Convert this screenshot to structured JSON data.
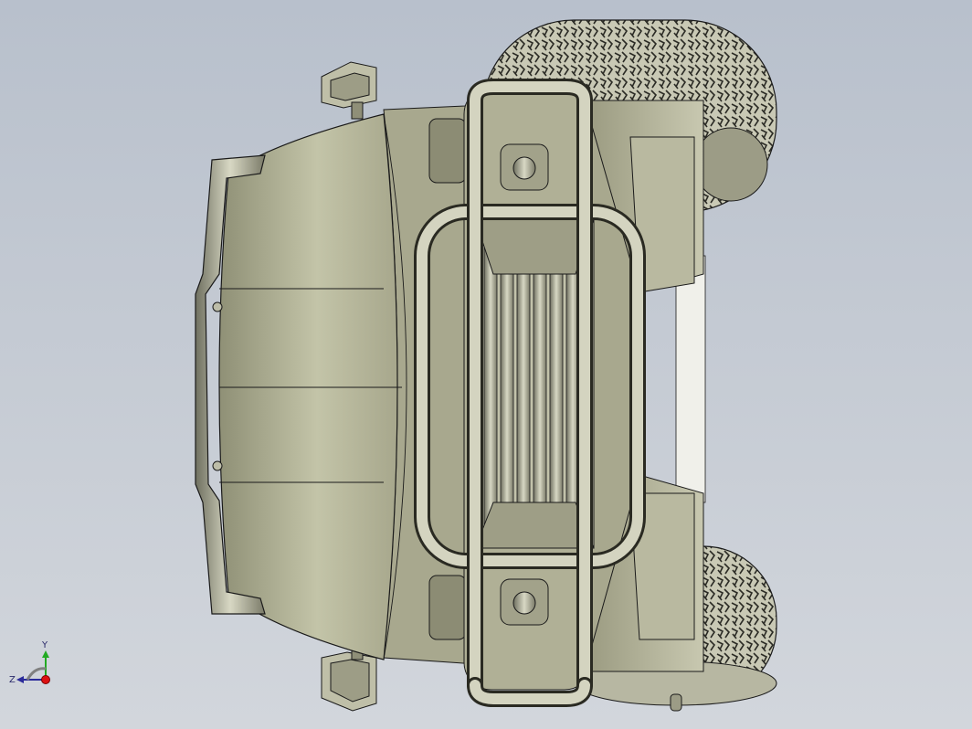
{
  "viewport": {
    "background_top": "#b8c0cc",
    "background_bottom": "#d2d6dc",
    "model_fill": "#b5b59a",
    "model_edge": "#1a1a1a"
  },
  "triad": {
    "x_label": "",
    "y_label": "Y",
    "z_label": "Z",
    "y_color": "#22aa22",
    "z_color": "#2a2a9a",
    "origin_color": "#dd1111"
  }
}
